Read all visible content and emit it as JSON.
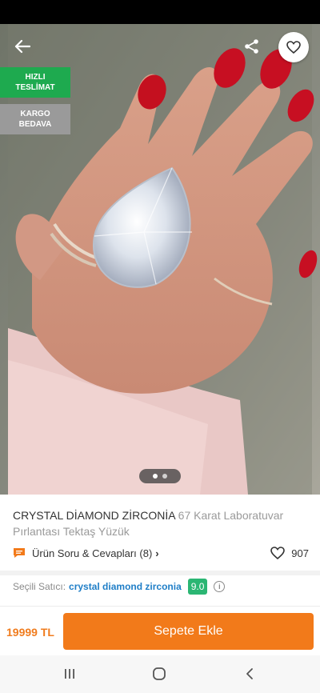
{
  "header": {
    "back_icon": "arrow-left-icon",
    "share_icon": "share-icon",
    "favorite_icon": "heart-outline-icon"
  },
  "badges": {
    "fast_delivery": [
      "HIZLI",
      "TESLİMAT"
    ],
    "free_cargo": [
      "KARGO",
      "BEDAVA"
    ],
    "fast_color": "#1eaa4f",
    "cargo_color": "#9a9a9a"
  },
  "gallery": {
    "current": 1,
    "total": 2
  },
  "product": {
    "brand": "CRYSTAL DİAMOND ZİRCONİA",
    "name": "67 Karat Laboratuvar Pırlantası Tektaş Yüzük"
  },
  "qa": {
    "label": "Ürün Soru & Cevapları (8)",
    "icon": "chat-bubble-icon",
    "chevron": "›"
  },
  "favorites": {
    "count": "907",
    "icon": "heart-outline-icon"
  },
  "seller": {
    "label": "Seçili Satıcı:",
    "name": "crystal diamond zirconia",
    "rating": "9.0",
    "rating_color": "#2bb673"
  },
  "purchase": {
    "price": "19999 TL",
    "button_label": "Sepete Ekle",
    "accent": "#f27a1a"
  },
  "system_nav": {
    "recent_icon": "recent-apps-icon",
    "home_icon": "home-circle-icon",
    "back_icon": "back-chevron-icon"
  }
}
